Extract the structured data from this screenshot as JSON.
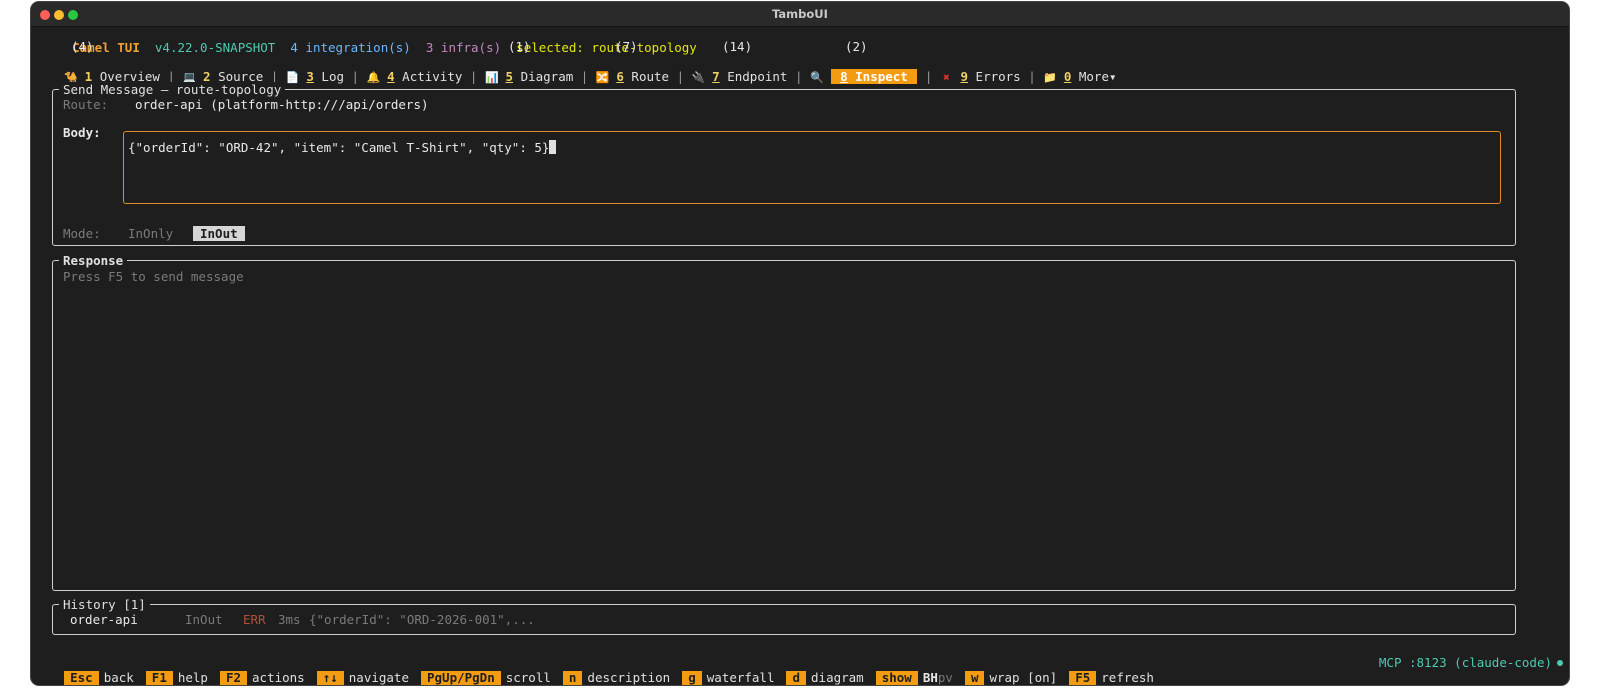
{
  "window": {
    "title": "TamboUI"
  },
  "status_line": {
    "app_name": "Camel TUI",
    "version": "v4.22.0-SNAPSHOT",
    "integrations": "4 integration(s)",
    "infra": "3 infra(s)",
    "selected": "selected: route-topology"
  },
  "tabs": [
    {
      "icon": "🐪",
      "icon_name": "camel-icon",
      "num": "1",
      "label": "Overview",
      "count": "(4)"
    },
    {
      "icon": "💻",
      "icon_name": "laptop-icon",
      "num": "2",
      "label": "Source",
      "count": ""
    },
    {
      "icon": "📄",
      "icon_name": "document-icon",
      "num": "3",
      "label": "Log",
      "count": ""
    },
    {
      "icon": "🔔",
      "icon_name": "bell-icon",
      "num": "4",
      "label": "Activity",
      "count": ""
    },
    {
      "icon": "📊",
      "icon_name": "chart-icon",
      "num": "5",
      "label": "Diagram",
      "count": "(1)"
    },
    {
      "icon": "🔀",
      "icon_name": "shuffle-icon",
      "num": "6",
      "label": "Route",
      "count": "(7)"
    },
    {
      "icon": "🔌",
      "icon_name": "plug-icon",
      "num": "7",
      "label": "Endpoint",
      "count": "(14)"
    },
    {
      "icon": "🔍",
      "icon_name": "magnifier-icon",
      "num": "8",
      "label": "Inspect",
      "count": "(2)"
    },
    {
      "icon": "✖",
      "icon_name": "error-x-icon",
      "num": "9",
      "label": "Errors",
      "count": ""
    },
    {
      "icon": "📁",
      "icon_name": "folder-icon",
      "num": "0",
      "label": "More▾",
      "count": ""
    }
  ],
  "send_panel": {
    "title": "Send Message — route-topology",
    "route_label": "Route:",
    "route_value": "order-api (platform-http:///api/orders)",
    "body_label": "Body:",
    "body_value": "{\"orderId\": \"ORD-42\", \"item\": \"Camel T-Shirt\", \"qty\": 5}",
    "mode_label": "Mode:",
    "mode_inonly": "InOnly",
    "mode_inout": "InOut"
  },
  "response_panel": {
    "title": "Response",
    "hint": "Press F5 to send message"
  },
  "history_panel": {
    "title": "History [1]",
    "row": {
      "route": "order-api",
      "mode": "InOut",
      "status": "ERR",
      "duration": "3ms",
      "body": "{\"orderId\": \"ORD-2026-001\",..."
    }
  },
  "footer": {
    "keys": [
      {
        "key": "Esc",
        "label": "back"
      },
      {
        "key": "F1",
        "label": "help"
      },
      {
        "key": "F2",
        "label": "actions"
      },
      {
        "key": "↑↓",
        "label": "navigate"
      },
      {
        "key": "PgUp/PgDn",
        "label": "scroll"
      },
      {
        "key": "n",
        "label": "description"
      },
      {
        "key": "g",
        "label": "waterfall"
      },
      {
        "key": "d",
        "label": "diagram"
      }
    ],
    "show_key": "show",
    "show_bold": "BH",
    "show_rest": "pv",
    "keys2": [
      {
        "key": "w",
        "label": "wrap [on]"
      },
      {
        "key": "F5",
        "label": "refresh"
      }
    ],
    "mcp": "MCP :8123 (claude-code)"
  },
  "colors": {
    "accent": "#f39c12",
    "body_border": "#e08a2c",
    "teal": "#4ec9b0",
    "error": "#b0503a"
  }
}
